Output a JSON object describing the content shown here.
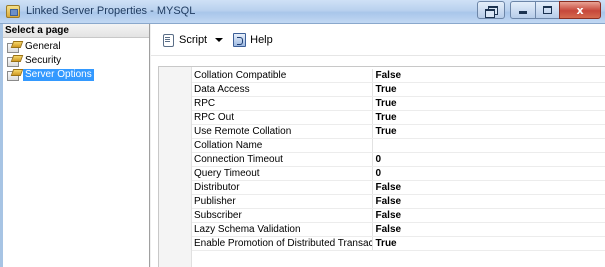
{
  "window": {
    "title": "Linked Server Properties - MYSQL",
    "buttons": {
      "close": "x"
    }
  },
  "sidebar": {
    "header": "Select a page",
    "items": [
      {
        "label": "General",
        "selected": false
      },
      {
        "label": "Security",
        "selected": false
      },
      {
        "label": "Server Options",
        "selected": true
      }
    ]
  },
  "toolbar": {
    "script_label": "Script",
    "help_label": "Help"
  },
  "properties": [
    {
      "name": "Collation Compatible",
      "value": "False"
    },
    {
      "name": "Data Access",
      "value": "True"
    },
    {
      "name": "RPC",
      "value": "True"
    },
    {
      "name": "RPC Out",
      "value": "True"
    },
    {
      "name": "Use Remote Collation",
      "value": "True"
    },
    {
      "name": "Collation Name",
      "value": ""
    },
    {
      "name": "Connection Timeout",
      "value": "0"
    },
    {
      "name": "Query Timeout",
      "value": "0"
    },
    {
      "name": "Distributor",
      "value": "False"
    },
    {
      "name": "Publisher",
      "value": "False"
    },
    {
      "name": "Subscriber",
      "value": "False"
    },
    {
      "name": "Lazy Schema Validation",
      "value": "False"
    },
    {
      "name": "Enable Promotion of Distributed Transaction",
      "value": "True"
    }
  ],
  "colors": {
    "selection": "#3399ff",
    "titlebar": "#b9d1ee"
  }
}
